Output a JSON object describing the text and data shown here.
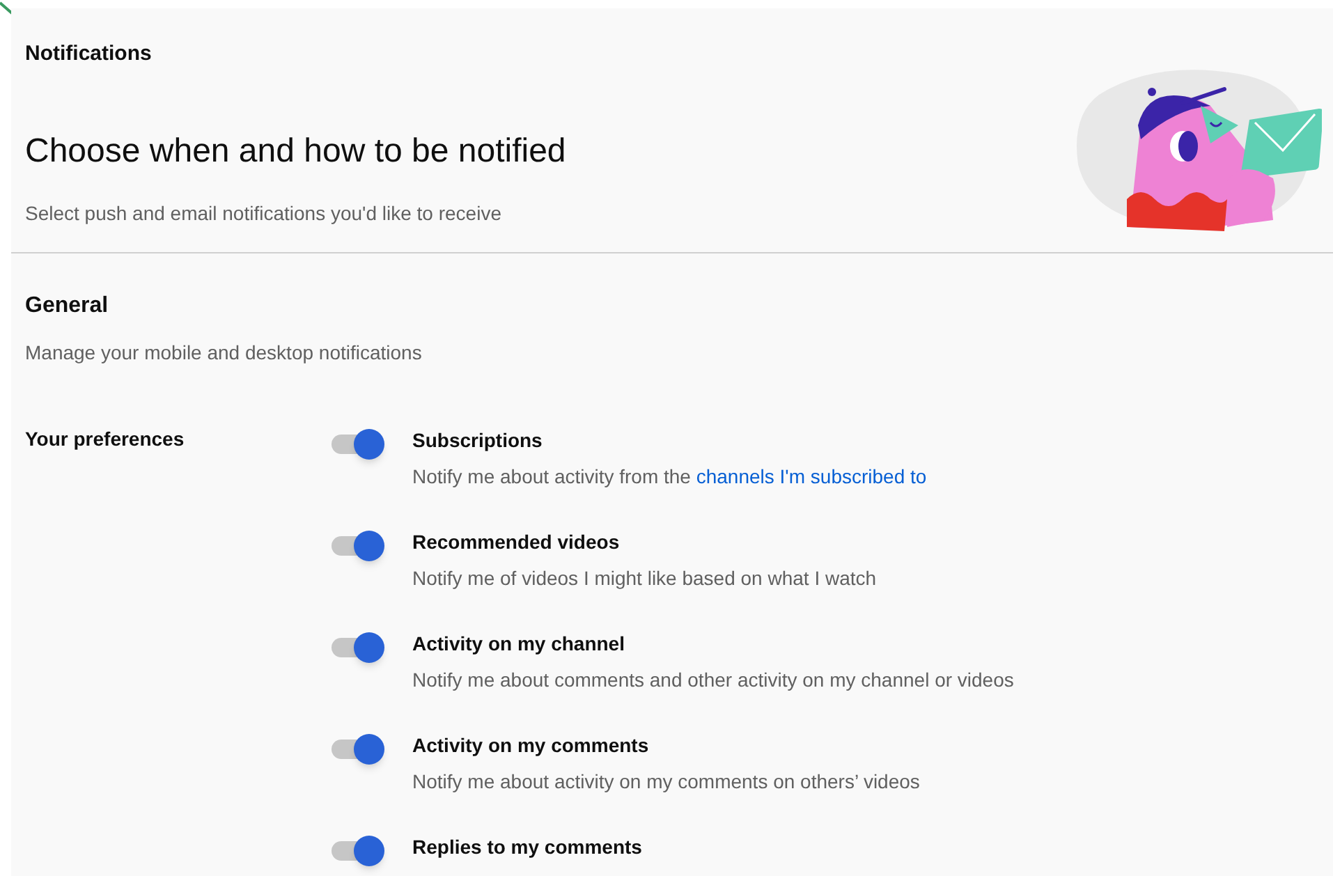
{
  "page_title": "Notifications",
  "header": {
    "title": "Choose when and how to be notified",
    "subtitle": "Select push and email notifications you'd like to receive"
  },
  "section": {
    "title": "General",
    "subtitle": "Manage your mobile and desktop notifications"
  },
  "preferences_label": "Your preferences",
  "preferences": [
    {
      "title": "Subscriptions",
      "description": "Notify me about activity from the ",
      "link": "channels I'm subscribed to",
      "on": true
    },
    {
      "title": "Recommended videos",
      "description": "Notify me of videos I might like based on what I watch",
      "on": true
    },
    {
      "title": "Activity on my channel",
      "description": "Notify me about comments and other activity on my channel or videos",
      "on": true
    },
    {
      "title": "Activity on my comments",
      "description": "Notify me about activity on my comments on others’ videos",
      "on": true
    },
    {
      "title": "Replies to my comments",
      "on": true
    }
  ]
}
